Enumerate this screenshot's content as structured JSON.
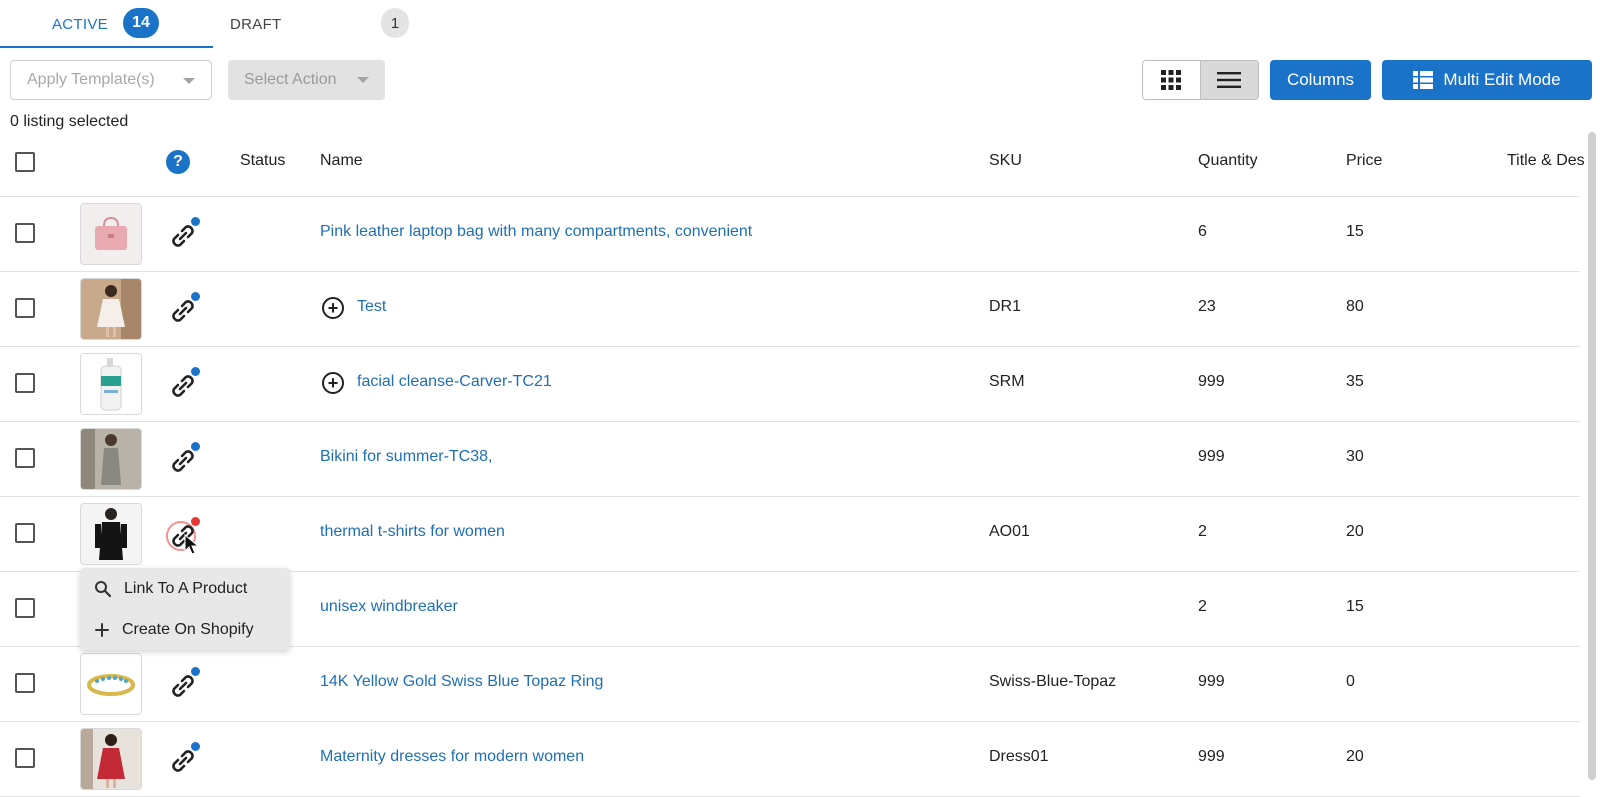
{
  "tabs": {
    "active": {
      "label": "ACTIVE",
      "count": "14"
    },
    "draft": {
      "label": "DRAFT",
      "count": "1"
    }
  },
  "toolbar": {
    "apply_template": "Apply Template(s)",
    "select_action": "Select Action",
    "columns": "Columns",
    "multi_edit": "Multi Edit Mode"
  },
  "selection": {
    "text": "0 listing selected"
  },
  "table": {
    "headers": {
      "status": "Status",
      "name": "Name",
      "sku": "SKU",
      "quantity": "Quantity",
      "price": "Price",
      "title_desc": "Title & Des"
    },
    "rows": [
      {
        "name": "Pink leather laptop bag with many compartments, convenient",
        "sku": "",
        "quantity": "6",
        "price": "15",
        "link_status": "blue",
        "has_plus": false,
        "thumb": "pink-bag"
      },
      {
        "name": "Test",
        "sku": "DR1",
        "quantity": "23",
        "price": "80",
        "link_status": "blue",
        "has_plus": true,
        "thumb": "white-dress"
      },
      {
        "name": "facial cleanse-Carver-TC21",
        "sku": "SRM",
        "quantity": "999",
        "price": "35",
        "link_status": "blue",
        "has_plus": true,
        "thumb": "cleanser-bottle"
      },
      {
        "name": "Bikini for summer-TC38,",
        "sku": "",
        "quantity": "999",
        "price": "30",
        "link_status": "blue",
        "has_plus": false,
        "thumb": "grey-dress"
      },
      {
        "name": "thermal t-shirts for women",
        "sku": "AO01",
        "quantity": "2",
        "price": "20",
        "link_status": "red",
        "has_plus": false,
        "thumb": "black-top"
      },
      {
        "name": "unisex windbreaker",
        "sku": "",
        "quantity": "2",
        "price": "15",
        "link_status": "hidden",
        "has_plus": false,
        "thumb": "hidden"
      },
      {
        "name": "14K Yellow Gold Swiss Blue Topaz Ring",
        "sku": "Swiss-Blue-Topaz",
        "quantity": "999",
        "price": "0",
        "link_status": "blue",
        "has_plus": false,
        "thumb": "gold-ring"
      },
      {
        "name": "Maternity dresses for modern women",
        "sku": "Dress01",
        "quantity": "999",
        "price": "20",
        "link_status": "blue",
        "has_plus": false,
        "thumb": "red-dress"
      }
    ]
  },
  "popup_menu": {
    "items": [
      {
        "label": "Link To A Product",
        "icon": "search-icon"
      },
      {
        "label": "Create On Shopify",
        "icon": "plus-icon"
      }
    ]
  },
  "colors": {
    "accent": "#1a73c8",
    "link_text": "#1f6fb5",
    "alert_dot": "#e53935"
  }
}
